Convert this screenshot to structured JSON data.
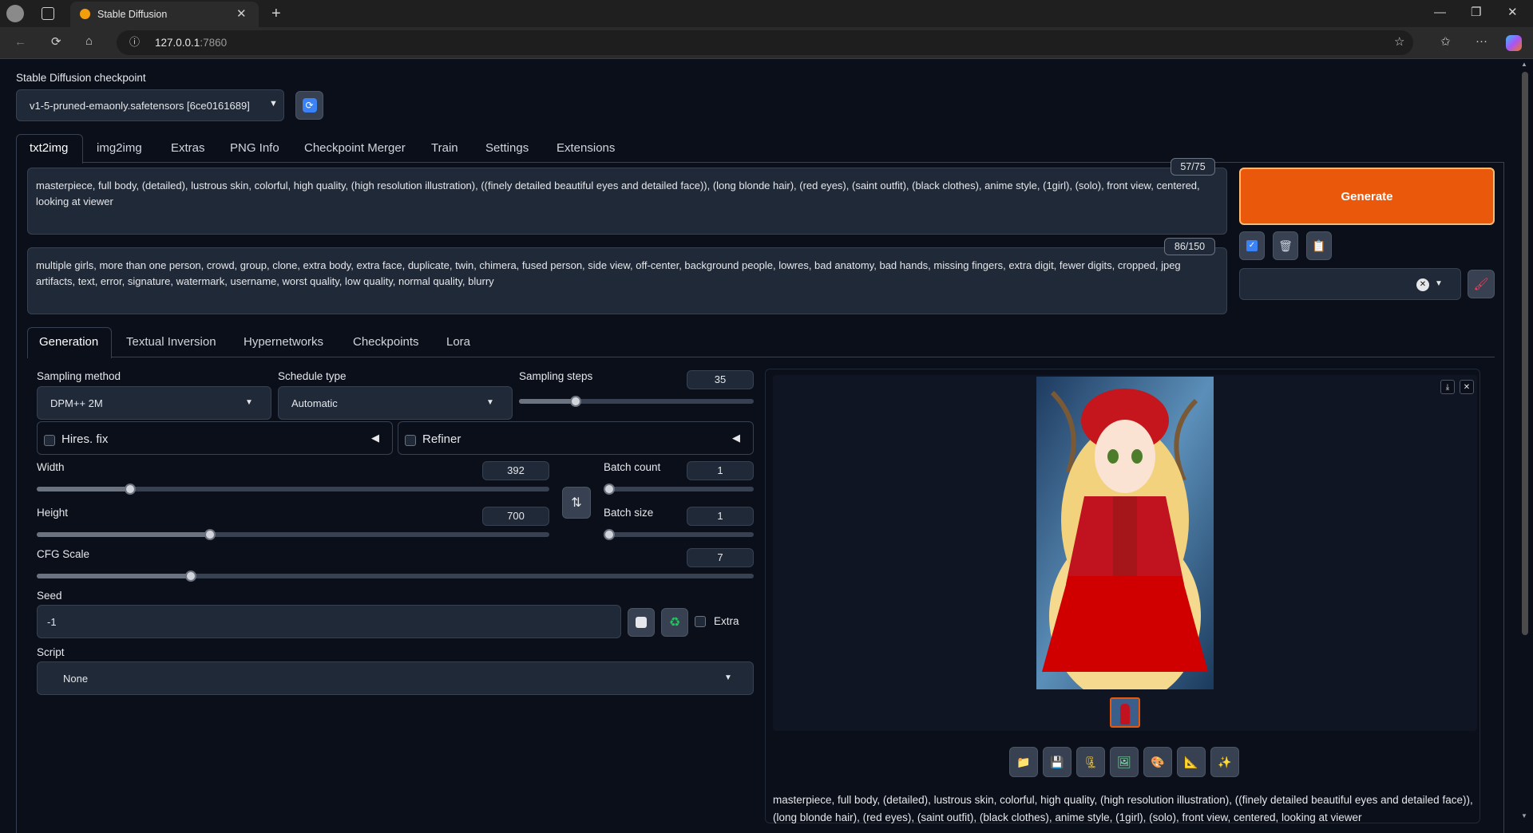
{
  "browser": {
    "tab_title": "Stable Diffusion",
    "address_host": "127.0.0.1",
    "address_port": ":7860"
  },
  "checkpoint": {
    "label": "Stable Diffusion checkpoint",
    "value": "v1-5-pruned-emaonly.safetensors [6ce0161689]"
  },
  "main_tabs": [
    "txt2img",
    "img2img",
    "Extras",
    "PNG Info",
    "Checkpoint Merger",
    "Train",
    "Settings",
    "Extensions"
  ],
  "prompt": {
    "counter": "57/75",
    "text": "masterpiece, full body, (detailed), lustrous skin, colorful, high quality, (high resolution illustration), ((finely detailed beautiful eyes and detailed face)),  (long blonde hair), (red eyes), (saint outfit), (black clothes), anime style, (1girl), (solo), front view, centered, looking at viewer"
  },
  "negative_prompt": {
    "counter": "86/150",
    "text": "multiple girls, more than one person, crowd, group, clone, extra body, extra face, duplicate, twin, chimera, fused person, side view, off-center, background people, lowres, bad anatomy, bad hands, missing fingers, extra digit, fewer digits, cropped, jpeg artifacts, text, error, signature, watermark, username, worst quality, low quality, normal quality, blurry"
  },
  "generate_label": "Generate",
  "sub_tabs": [
    "Generation",
    "Textual Inversion",
    "Hypernetworks",
    "Checkpoints",
    "Lora"
  ],
  "generation": {
    "sampling_method_label": "Sampling method",
    "sampling_method": "DPM++ 2M",
    "schedule_type_label": "Schedule type",
    "schedule_type": "Automatic",
    "sampling_steps_label": "Sampling steps",
    "sampling_steps": "35",
    "hires_fix_label": "Hires. fix",
    "refiner_label": "Refiner",
    "width_label": "Width",
    "width": "392",
    "height_label": "Height",
    "height": "700",
    "batch_count_label": "Batch count",
    "batch_count": "1",
    "batch_size_label": "Batch size",
    "batch_size": "1",
    "cfg_label": "CFG Scale",
    "cfg": "7",
    "seed_label": "Seed",
    "seed": "-1",
    "extra_label": "Extra",
    "script_label": "Script",
    "script": "None"
  },
  "output_caption": "masterpiece, full body, (detailed), lustrous skin, colorful, high quality, (high resolution illustration), ((finely detailed beautiful eyes and detailed face)), (long blonde hair), (red eyes), (saint outfit), (black clothes), anime style, (1girl), (solo), front view, centered, looking at viewer",
  "sliders": {
    "sampling_steps_fraction": 0.23,
    "width_fraction": 0.175,
    "height_fraction": 0.335,
    "cfg_fraction": 0.21,
    "batch_count_fraction": 0.0,
    "batch_size_fraction": 0.0
  },
  "colors": {
    "generate": "#ea580c",
    "background": "#0b0f19",
    "accent_blue": "#3b82f6"
  },
  "icons": [
    "refresh-icon",
    "paint-icon",
    "trash-icon",
    "clipboard-icon",
    "clear-icon",
    "brush-icon",
    "swap-icon",
    "dice-icon",
    "recycle-icon",
    "folder-icon",
    "save-icon",
    "zip-icon",
    "image-icon",
    "palette-icon",
    "ruler-icon",
    "sparkle-icon",
    "download-icon",
    "close-icon"
  ]
}
